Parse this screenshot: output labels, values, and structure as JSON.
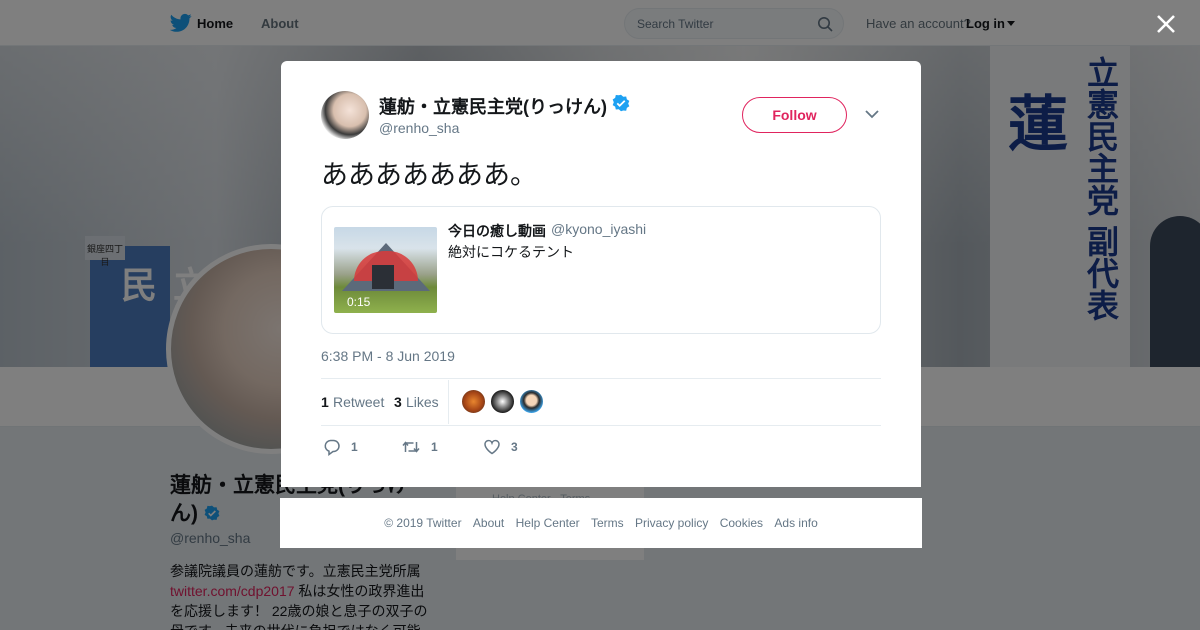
{
  "topnav": {
    "home_label": "Home",
    "about_label": "About",
    "search_placeholder": "Search Twitter",
    "have_account": "Have an account?",
    "login_label": "Log in"
  },
  "profile": {
    "name": "蓮舫・立憲民主党(りっけん)",
    "handle": "@renho_sha",
    "bio_before": "参議院議員の蓮舫です。立憲民主党所属",
    "bio_link": "twitter.com/cdp2017",
    "bio_after": " 私は女性の政界進出を応援します！ 22歳の娘と息子の双子の母です。未来の世代に負担ではなく可能",
    "side_help": "Help Center · Terms"
  },
  "banner": {
    "sign1_text": "立憲民",
    "sign2_big": "蓮",
    "sign2_small": "立憲民主党 副代表",
    "sign3_text": "銀座四丁目"
  },
  "modal": {
    "author_name": "蓮舫・立憲民主党(りっけん)",
    "author_handle": "@renho_sha",
    "follow_label": "Follow",
    "tweet_text": "あああああああ。",
    "quote": {
      "name": "今日の癒し動画",
      "handle": "@kyono_iyashi",
      "text": "絶対にコケるテント",
      "duration": "0:15"
    },
    "timestamp": "6:38 PM - 8 Jun 2019",
    "stats": {
      "retweet_count": "1",
      "retweet_label": "Retweet",
      "like_count": "3",
      "like_label": "Likes"
    },
    "actions": {
      "reply_count": "1",
      "retweet_count": "1",
      "like_count": "3"
    }
  },
  "footer": {
    "copyright": "© 2019 Twitter",
    "about": "About",
    "help": "Help Center",
    "terms": "Terms",
    "privacy": "Privacy policy",
    "cookies": "Cookies",
    "ads": "Ads info"
  },
  "colors": {
    "accent": "#e0245e",
    "twitter_blue": "#1da1f2",
    "muted": "#657786"
  }
}
